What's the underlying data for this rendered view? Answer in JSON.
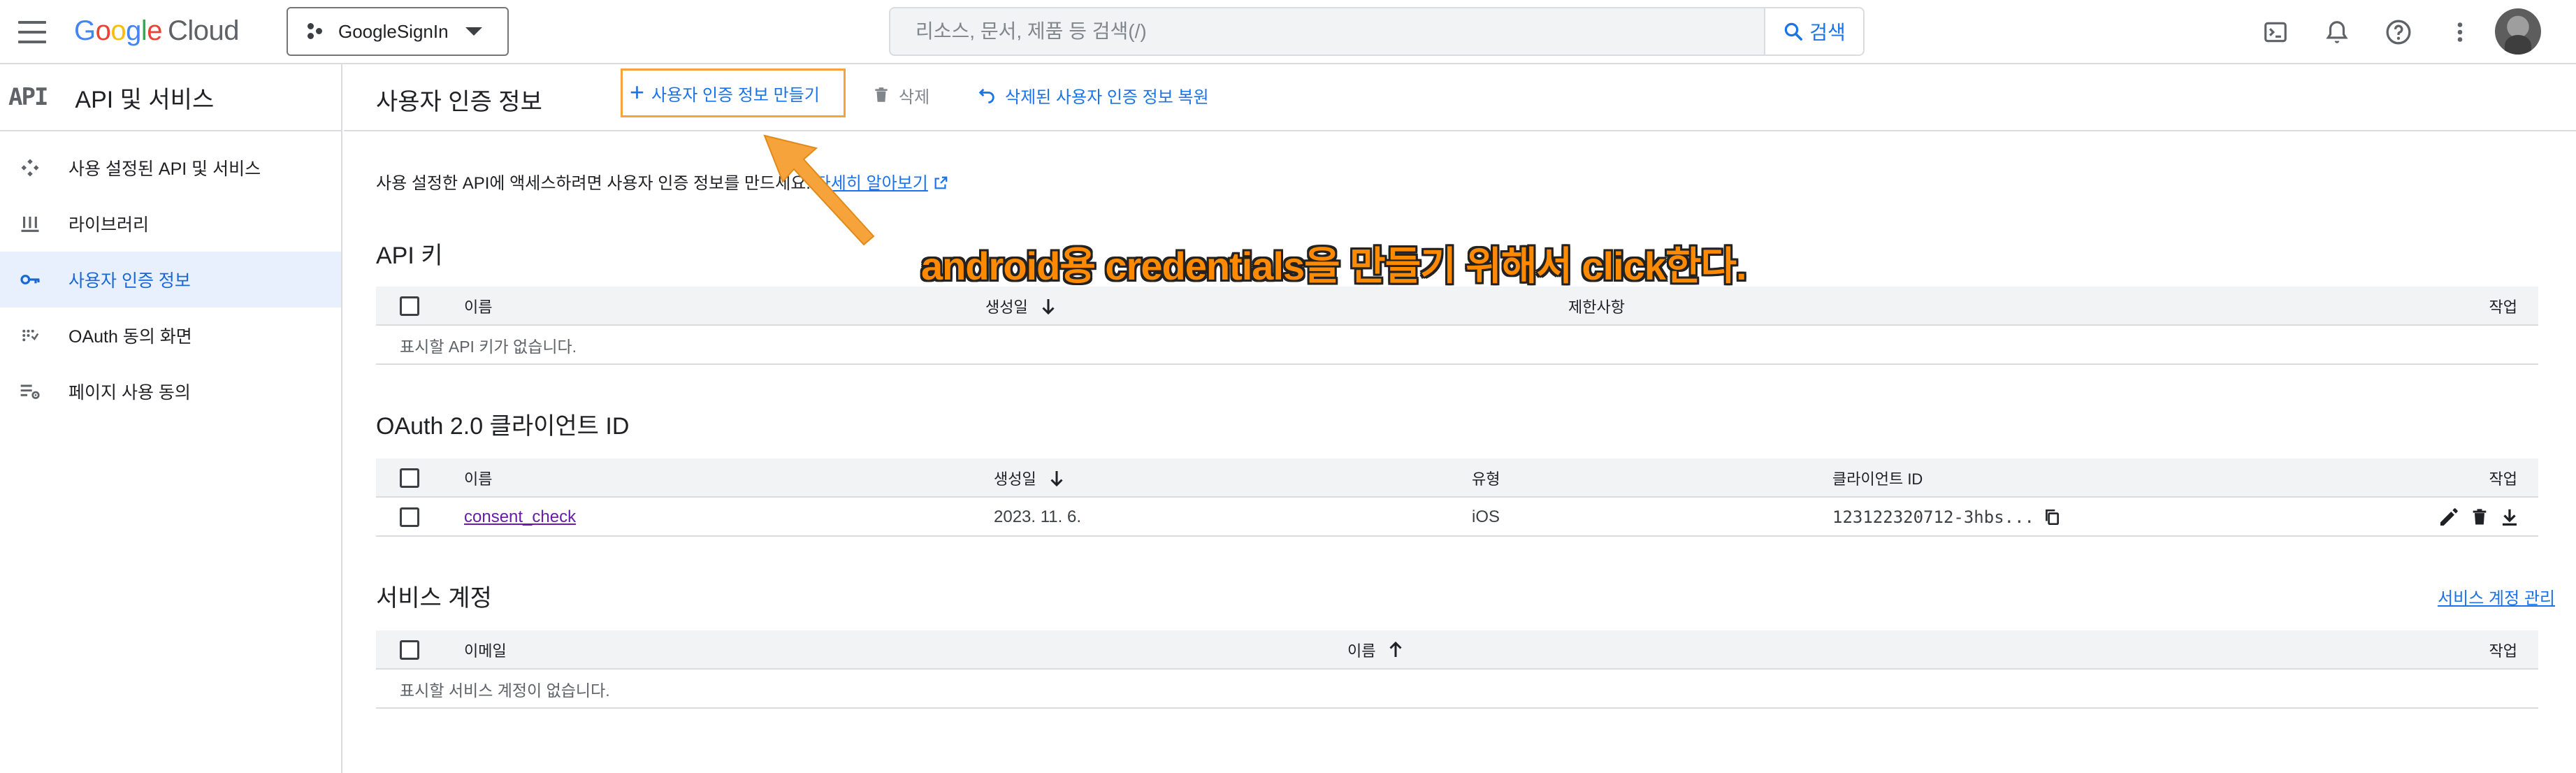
{
  "topbar": {
    "logo_letters": [
      "G",
      "o",
      "o",
      "g",
      "l",
      "e"
    ],
    "logo_suffix": "Cloud",
    "project_name": "GoogleSignIn",
    "search_placeholder": "리소스, 문서, 제품 등 검색(/)",
    "search_button": "검색",
    "icons": [
      "cloud-shell-icon",
      "bell-icon",
      "help-icon",
      "more-vert-icon"
    ]
  },
  "sidebar": {
    "api_logo": "API",
    "title": "API 및 서비스",
    "items": [
      {
        "label": "사용 설정된 API 및 서비스",
        "icon": "enabled-apis-icon",
        "active": false
      },
      {
        "label": "라이브러리",
        "icon": "library-icon",
        "active": false
      },
      {
        "label": "사용자 인증 정보",
        "icon": "key-icon",
        "active": true
      },
      {
        "label": "OAuth 동의 화면",
        "icon": "oauth-consent-icon",
        "active": false
      },
      {
        "label": "페이지 사용 동의",
        "icon": "page-usage-icon",
        "active": false
      }
    ]
  },
  "toolbar": {
    "title": "사용자 인증 정보",
    "create_label": "사용자 인증 정보 만들기",
    "delete_label": "삭제",
    "restore_label": "삭제된 사용자 인증 정보 복원"
  },
  "intro": {
    "text": "사용 설정한 API에 액세스하려면 사용자 인증 정보를 만드세요.",
    "link": "자세히 알아보기"
  },
  "api_keys": {
    "title": "API 키",
    "columns": [
      "이름",
      "생성일",
      "제한사항",
      "작업"
    ],
    "empty": "표시할 API 키가 없습니다."
  },
  "oauth": {
    "title": "OAuth 2.0 클라이언트 ID",
    "columns": [
      "이름",
      "생성일",
      "유형",
      "클라이언트 ID",
      "작업"
    ],
    "rows": [
      {
        "name": "consent_check",
        "created": "2023. 11. 6.",
        "type": "iOS",
        "client_id": "123122320712-3hbs..."
      }
    ]
  },
  "service_accounts": {
    "title": "서비스 계정",
    "manage_link": "서비스 계정 관리",
    "columns": [
      "이메일",
      "이름",
      "작업"
    ],
    "empty": "표시할 서비스 계정이 없습니다."
  },
  "annotation": {
    "text": "android용 credentials을 만들기 위해서 click한다.",
    "color": "#ff8a00"
  },
  "colors": {
    "accent": "#1a73e8",
    "active_bg": "#e8f0fe",
    "link_visited": "#681da8",
    "highlight_border": "#f6a33b"
  }
}
